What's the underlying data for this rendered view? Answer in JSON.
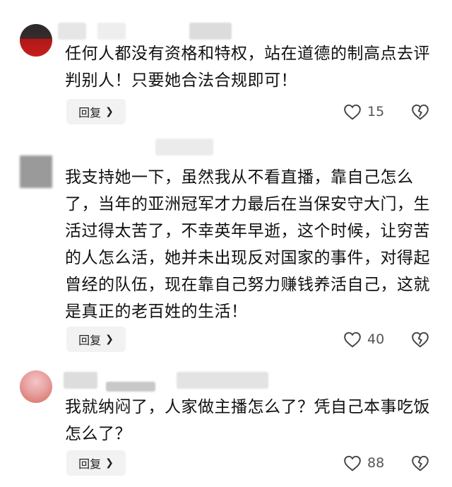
{
  "comments": [
    {
      "text": "任何人都没有资格和特权，站在道德的制高点去评判别人！只要她合法合规即可！",
      "reply_label": "回复",
      "likes": "15"
    },
    {
      "text": "我支持她一下，虽然我从不看直播，靠自己怎么了，当年的亚洲冠军才力最后在当保安守大门，生活过得太苦了，不幸英年早逝，这个时候，让穷苦的人怎么活，她并未出现反对国家的事件，对得起曾经的队伍，现在靠自己努力赚钱养活自己，这就是真正的老百姓的生活！",
      "reply_label": "回复",
      "likes": "40"
    },
    {
      "text": "我就纳闷了，人家做主播怎么了？凭自己本事吃饭怎么了？",
      "reply_label": "回复",
      "likes": "88"
    }
  ],
  "icons": {
    "like": "heart-outline-icon",
    "dislike": "broken-heart-icon",
    "reply_chevron": "chevron-right-icon"
  },
  "colors": {
    "text": "#111111",
    "muted": "#555555",
    "button_bg": "#f2f2f2"
  }
}
